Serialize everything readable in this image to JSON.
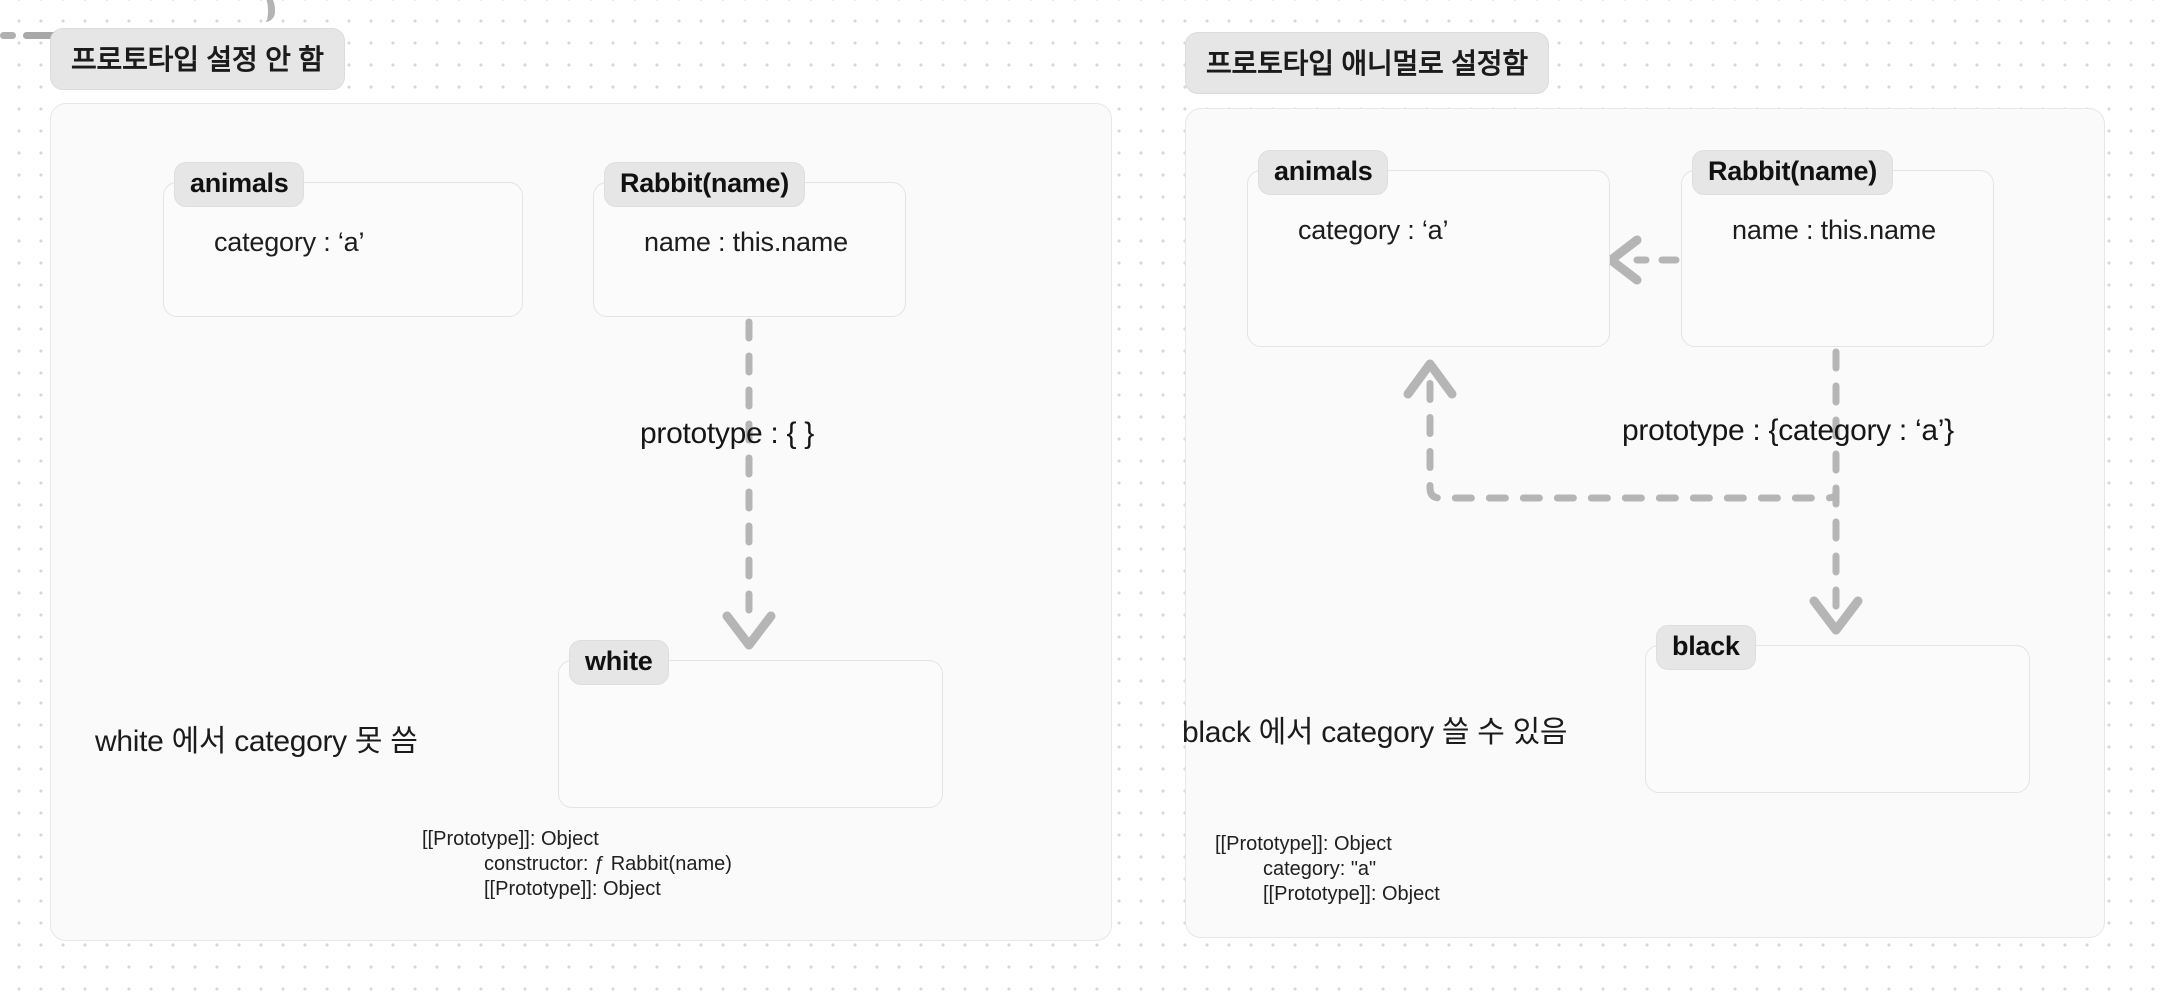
{
  "canvas": {
    "background_color": "#ffffff",
    "dot_color": "#d8d8d8",
    "panel_fill": "#fafafa",
    "panel_border": "#e7e7e7",
    "chip_fill": "#e6e6e6",
    "arrow_color": "#b5b5b5",
    "text_color": "#1b1b1b"
  },
  "panels": {
    "left": {
      "title": "프로토타입 설정 안 함",
      "note": "white 에서 category 못 씀",
      "boxes": {
        "animals": {
          "chip": "animals",
          "prop": "category : ‘a’"
        },
        "rabbit": {
          "chip": "Rabbit(name)",
          "prop": "name : this.name"
        },
        "instance": {
          "chip": "white",
          "prop": ""
        }
      },
      "edges": {
        "prototype_label": "prototype : { }"
      },
      "caption": {
        "line1": "[[Prototype]]: Object",
        "line2": "constructor: ƒ Rabbit(name)",
        "line3": "[[Prototype]]: Object"
      }
    },
    "right": {
      "title": "프로토타입 애니멀로 설정함",
      "note": "black 에서 category 쓸 수 있음",
      "boxes": {
        "animals": {
          "chip": "animals",
          "prop": "category : ‘a’"
        },
        "rabbit": {
          "chip": "Rabbit(name)",
          "prop": "name : this.name"
        },
        "instance": {
          "chip": "black",
          "prop": ""
        }
      },
      "edges": {
        "prototype_label": "prototype : {category : ‘a’}"
      },
      "caption": {
        "line1": "[[Prototype]]: Object",
        "line2": "category: \"a\"",
        "line3": "[[Prototype]]: Object"
      }
    }
  }
}
